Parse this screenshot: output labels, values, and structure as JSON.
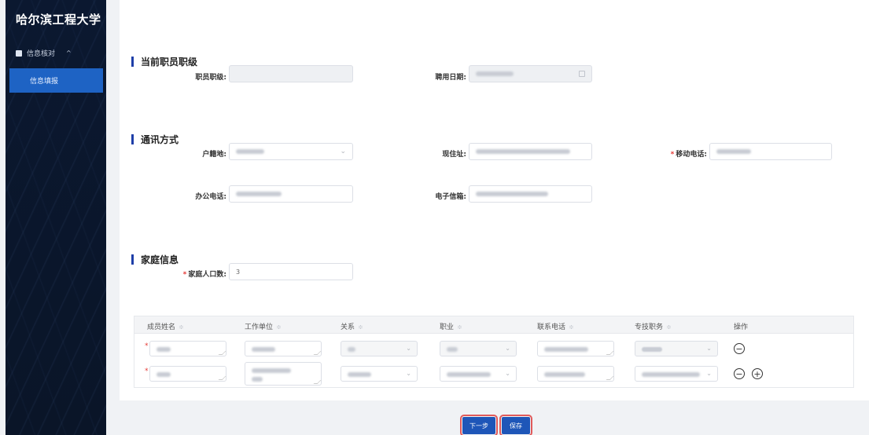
{
  "sidebar": {
    "logo": "哈尔滨工程大学",
    "group_label": "信息核对",
    "group_chevron": "^",
    "active_item": "信息填报"
  },
  "sections": {
    "rank": {
      "title": "当前职员职级",
      "rank_label": "职员职级:",
      "hire_date_label": "聘用日期:"
    },
    "contact": {
      "title": "通讯方式",
      "household_label": "户籍地:",
      "address_label": "现住址:",
      "mobile_label": "移动电话:",
      "office_phone_label": "办公电话:",
      "email_label": "电子信箱:"
    },
    "family": {
      "title": "家庭信息",
      "count_label": "家庭人口数:",
      "count_value": "3"
    }
  },
  "table": {
    "columns": [
      "成员姓名",
      "工作单位",
      "关系",
      "职业",
      "联系电话",
      "专技职务",
      "操作"
    ],
    "sort_glyph": "≑",
    "rows": [
      {
        "remove_icon": "−"
      },
      {
        "remove_icon": "−",
        "add_icon": "+"
      }
    ],
    "tech_post_placeholder": "请选择"
  },
  "footer": {
    "next_label": "下一步",
    "save_label": "保存"
  },
  "colors": {
    "sidebar_bg": "#0b1830",
    "accent": "#1e63c4",
    "required": "#e53935",
    "button_outline": "#e05a5a"
  }
}
